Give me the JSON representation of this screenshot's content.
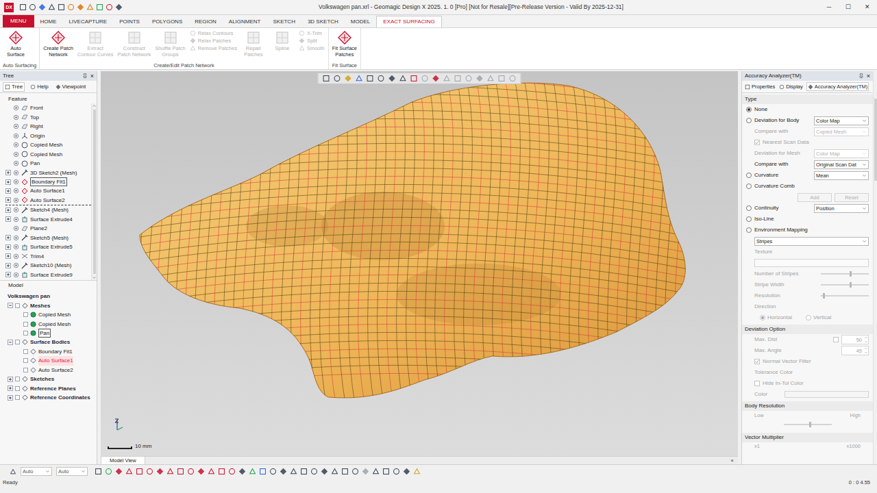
{
  "window": {
    "logo": "DX",
    "title": "Volkswagen pan.xrl - Geomagic Design X 2025. 1. 0 [Pro] [Not for Resale][Pre-Release Version - Valid By 2025-12-31]",
    "controls": [
      "─",
      "☐",
      "✕"
    ]
  },
  "ribbon_tabs": [
    {
      "label": "MENU",
      "kind": "app",
      "selected": false
    },
    {
      "label": "HOME",
      "kind": "tab",
      "selected": false
    },
    {
      "label": "LIVECAPTURE",
      "kind": "tab",
      "selected": false
    },
    {
      "label": "POINTS",
      "kind": "tab",
      "selected": false
    },
    {
      "label": "POLYGONS",
      "kind": "tab",
      "selected": false
    },
    {
      "label": "REGION",
      "kind": "tab",
      "selected": false
    },
    {
      "label": "ALIGNMENT",
      "kind": "tab",
      "selected": false
    },
    {
      "label": "SKETCH",
      "kind": "tab",
      "selected": false
    },
    {
      "label": "3D SKETCH",
      "kind": "tab",
      "selected": false
    },
    {
      "label": "MODEL",
      "kind": "tab",
      "selected": false
    },
    {
      "label": "EXACT SURFACING",
      "kind": "tab",
      "selected": true
    }
  ],
  "ribbon_groups": [
    {
      "label": "Auto Surfacing",
      "buttons": [
        {
          "kind": "large",
          "lines": [
            "Auto",
            "Surface"
          ],
          "disabled": false
        }
      ]
    },
    {
      "label": "Create/Edit Patch Network",
      "buttons": [
        {
          "kind": "large",
          "lines": [
            "Create Patch",
            "Network"
          ],
          "disabled": false
        },
        {
          "kind": "large",
          "lines": [
            "Extract",
            "Contour Curves"
          ],
          "disabled": true
        },
        {
          "kind": "large",
          "lines": [
            "Construct",
            "Patch Network"
          ],
          "disabled": true
        },
        {
          "kind": "large",
          "lines": [
            "Shuffle Patch",
            "Groups"
          ],
          "disabled": true
        },
        {
          "kind": "stack",
          "items": [
            {
              "label": "Relax Contours",
              "disabled": true
            },
            {
              "label": "Relax Patches",
              "disabled": true
            },
            {
              "label": "Remove Patches",
              "disabled": true
            }
          ]
        },
        {
          "kind": "large",
          "lines": [
            "Repair",
            "Patches"
          ],
          "disabled": true
        },
        {
          "kind": "large",
          "lines": [
            "Spline"
          ],
          "disabled": true
        },
        {
          "kind": "stack",
          "items": [
            {
              "label": "X-Trim",
              "disabled": true
            },
            {
              "label": "Split",
              "disabled": true
            },
            {
              "label": "Smooth",
              "disabled": true
            }
          ]
        }
      ]
    },
    {
      "label": "Fit Surface",
      "buttons": [
        {
          "kind": "large",
          "lines": [
            "Fit Surface",
            "Patches"
          ],
          "disabled": false
        }
      ]
    }
  ],
  "tree_panel": {
    "title": "Tree",
    "close": "×",
    "tabs": [
      {
        "label": "Tree",
        "selected": true
      },
      {
        "label": "Help",
        "selected": false
      },
      {
        "label": "Viewpoint",
        "selected": false
      }
    ],
    "feature_header": "Feature",
    "features": [
      {
        "label": "Front",
        "kind": "plane",
        "expandable": false,
        "selected": false,
        "rollback": false
      },
      {
        "label": "Top",
        "kind": "plane",
        "expandable": false,
        "selected": false,
        "rollback": false
      },
      {
        "label": "Right",
        "kind": "plane",
        "expandable": false,
        "selected": false,
        "rollback": false
      },
      {
        "label": "Origin",
        "kind": "origin",
        "expandable": false,
        "selected": false,
        "rollback": false
      },
      {
        "label": "Copied Mesh",
        "kind": "mesh",
        "expandable": false,
        "selected": false,
        "rollback": false
      },
      {
        "label": "Copied Mesh",
        "kind": "mesh",
        "expandable": false,
        "selected": false,
        "rollback": false
      },
      {
        "label": "Pan",
        "kind": "mesh",
        "expandable": false,
        "selected": false,
        "rollback": false
      },
      {
        "label": "3D Sketch2 (Mesh)",
        "kind": "sketch3d",
        "expandable": true,
        "selected": false,
        "rollback": false
      },
      {
        "label": "Boundary Fit1",
        "kind": "surface",
        "expandable": true,
        "selected": true,
        "rollback": false
      },
      {
        "label": "Auto Surface1",
        "kind": "surface",
        "expandable": true,
        "selected": false,
        "rollback": false
      },
      {
        "label": "Auto Surface2",
        "kind": "surface",
        "expandable": true,
        "selected": false,
        "rollback": true
      },
      {
        "label": "Sketch4 (Mesh)",
        "kind": "sketch",
        "expandable": true,
        "selected": false,
        "rollback": false
      },
      {
        "label": "Surface Extrude4",
        "kind": "extrude",
        "expandable": true,
        "selected": false,
        "rollback": false
      },
      {
        "label": "Plane2",
        "kind": "plane",
        "expandable": false,
        "selected": false,
        "rollback": false
      },
      {
        "label": "Sketch5 (Mesh)",
        "kind": "sketch",
        "expandable": true,
        "selected": false,
        "rollback": false
      },
      {
        "label": "Surface Extrude5",
        "kind": "extrude",
        "expandable": true,
        "selected": false,
        "rollback": false
      },
      {
        "label": "Trim4",
        "kind": "trim",
        "expandable": true,
        "selected": false,
        "rollback": false
      },
      {
        "label": "Sketch10 (Mesh)",
        "kind": "sketch",
        "expandable": true,
        "selected": false,
        "rollback": false
      },
      {
        "label": "Surface Extrude9",
        "kind": "extrude",
        "expandable": true,
        "selected": false,
        "rollback": false
      }
    ],
    "model_header": "Model",
    "model_tree": [
      {
        "label": "Volkswagen pan",
        "depth": 0,
        "kind": "root",
        "expanded": true,
        "selected": false,
        "highlight": false
      },
      {
        "label": "Meshes",
        "depth": 1,
        "kind": "group",
        "expanded": true,
        "selected": false,
        "highlight": false
      },
      {
        "label": "Copied Mesh",
        "depth": 2,
        "kind": "mesh",
        "expanded": false,
        "selected": false,
        "highlight": false
      },
      {
        "label": "Copied Mesh",
        "depth": 2,
        "kind": "mesh",
        "expanded": false,
        "selected": false,
        "highlight": false
      },
      {
        "label": "Pan",
        "depth": 2,
        "kind": "mesh",
        "expanded": false,
        "selected": true,
        "highlight": false
      },
      {
        "label": "Surface Bodies",
        "depth": 1,
        "kind": "group",
        "expanded": true,
        "selected": false,
        "highlight": false
      },
      {
        "label": "Boundary Fit1",
        "depth": 2,
        "kind": "body",
        "expanded": false,
        "selected": false,
        "highlight": false
      },
      {
        "label": "Auto Surface1",
        "depth": 2,
        "kind": "body",
        "expanded": false,
        "selected": false,
        "highlight": true
      },
      {
        "label": "Auto Surface2",
        "depth": 2,
        "kind": "body",
        "expanded": false,
        "selected": false,
        "highlight": false
      },
      {
        "label": "Sketches",
        "depth": 1,
        "kind": "group",
        "expanded": false,
        "selected": false,
        "highlight": false
      },
      {
        "label": "Reference Planes",
        "depth": 1,
        "kind": "group",
        "expanded": false,
        "selected": false,
        "highlight": false
      },
      {
        "label": "Reference Coordinates",
        "depth": 1,
        "kind": "group",
        "expanded": false,
        "selected": false,
        "highlight": false
      }
    ]
  },
  "viewport": {
    "scale": "10 mm",
    "tab": "Model View",
    "tab_close": "×"
  },
  "analyzer_panel": {
    "title": "Accuracy Analyzer(TM)",
    "close": "×",
    "tabs": [
      {
        "label": "Properties",
        "selected": false
      },
      {
        "label": "Display",
        "selected": false
      },
      {
        "label": "Accuracy Analyzer(TM)",
        "selected": true
      }
    ],
    "rows": [
      {
        "kind": "section",
        "label": "Type"
      },
      {
        "kind": "radio",
        "label": "None",
        "selected": true,
        "disabled": false
      },
      {
        "kind": "radio",
        "label": "Deviation for Body",
        "selected": false,
        "disabled": false,
        "value": "Color Map"
      },
      {
        "kind": "sub",
        "label": "Compare with",
        "value": "Copied Mesh",
        "disabled": true
      },
      {
        "kind": "check",
        "label": "Nearest Scan Data",
        "checked": true,
        "disabled": true
      },
      {
        "kind": "sub",
        "label": "Deviation for Mesh",
        "value": "Color Map",
        "disabled": true
      },
      {
        "kind": "sub",
        "label": "Compare with",
        "value": "Original Scan Dat",
        "disabled": false
      },
      {
        "kind": "radio",
        "label": "Curvature",
        "selected": false,
        "disabled": false,
        "value": "Mean"
      },
      {
        "kind": "radio",
        "label": "Curvature Comb",
        "selected": false,
        "disabled": false
      },
      {
        "kind": "buttons",
        "labels": [
          "Add",
          "Reset"
        ],
        "disabled": true
      },
      {
        "kind": "radio",
        "label": "Continuity",
        "selected": false,
        "disabled": false,
        "value": "Position"
      },
      {
        "kind": "radio",
        "label": "Iso-Line",
        "selected": false,
        "disabled": false
      },
      {
        "kind": "radio",
        "label": "Environment Mapping",
        "selected": false,
        "disabled": false
      },
      {
        "kind": "select",
        "value": "Stripes",
        "disabled": false
      },
      {
        "kind": "label",
        "label": "Texture",
        "disabled": true
      },
      {
        "kind": "field",
        "value": "",
        "disabled": true
      },
      {
        "kind": "slider",
        "label": "Number of Stripes",
        "level": 0.62,
        "disabled": true
      },
      {
        "kind": "slider",
        "label": "Stripe Width",
        "level": 0.62,
        "disabled": true
      },
      {
        "kind": "slider",
        "label": "Resolution",
        "level": 0.05,
        "disabled": true
      },
      {
        "kind": "label",
        "label": "Direction",
        "disabled": true
      },
      {
        "kind": "radios",
        "options": [
          {
            "label": "Horizontal",
            "selected": true
          },
          {
            "label": "Vertical",
            "selected": false
          }
        ],
        "disabled": true
      },
      {
        "kind": "section",
        "label": "Deviation Option"
      },
      {
        "kind": "spin",
        "label": "Max. Dist",
        "value": "50",
        "has_checkbox": true,
        "checked": false,
        "disabled": true
      },
      {
        "kind": "spin",
        "label": "Max. Angle",
        "value": "45",
        "has_checkbox": false,
        "checked": false,
        "disabled": true
      },
      {
        "kind": "check",
        "label": "Normal Vector Filter",
        "checked": true,
        "disabled": true
      },
      {
        "kind": "label",
        "label": "Tolerance Color",
        "disabled": true
      },
      {
        "kind": "check",
        "label": "Hide In-Tol Color",
        "checked": false,
        "disabled": true
      },
      {
        "kind": "color",
        "label": "Color",
        "disabled": true
      },
      {
        "kind": "section",
        "label": "Body Resolution"
      },
      {
        "kind": "range",
        "low": "Low",
        "high": "High",
        "level": 0.55,
        "disabled": true
      },
      {
        "kind": "section",
        "label": "Vector Multiplier"
      },
      {
        "kind": "range-labels",
        "low": "x1",
        "high": "x1000",
        "disabled": true
      }
    ]
  },
  "bottom_bar": {
    "selectors": [
      "Auto",
      "Auto"
    ]
  },
  "status_bar": {
    "text": "Ready",
    "right": "0 : 0 4.55"
  }
}
